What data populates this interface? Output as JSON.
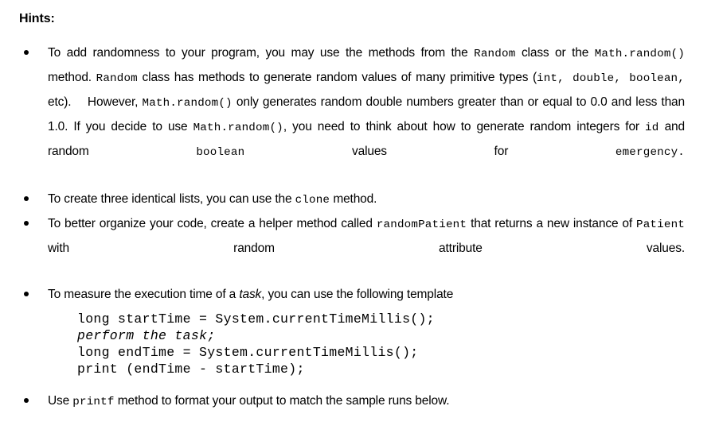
{
  "document": {
    "heading": "Hints:",
    "bullets": [
      {
        "id": "randomness",
        "segments": [
          {
            "text": "To add randomness to your program, you may use the methods from the ",
            "style": "normal"
          },
          {
            "text": "Random",
            "style": "code"
          },
          {
            "text": " class or the ",
            "style": "normal"
          },
          {
            "text": "Math.random()",
            "style": "code"
          },
          {
            "text": " method. ",
            "style": "normal"
          },
          {
            "text": "Random",
            "style": "code"
          },
          {
            "text": " class has methods to generate random values of many primitive types (",
            "style": "normal"
          },
          {
            "text": "int, double, boolean,",
            "style": "code"
          },
          {
            "text": " etc).  However, ",
            "style": "normal"
          },
          {
            "text": "Math.random()",
            "style": "code"
          },
          {
            "text": " only generates random double numbers greater than or equal to 0.0 and  less than 1.0. If you decide to use ",
            "style": "normal"
          },
          {
            "text": "Math.random()",
            "style": "code"
          },
          {
            "text": ", you need to think about how to generate random integers for ",
            "style": "normal"
          },
          {
            "text": "id",
            "style": "code"
          },
          {
            "text": " and random ",
            "style": "normal"
          },
          {
            "text": "boolean",
            "style": "code"
          },
          {
            "text": " values for ",
            "style": "normal"
          },
          {
            "text": "emergency.",
            "style": "code"
          }
        ]
      },
      {
        "id": "clone",
        "justify": false,
        "segments": [
          {
            "text": "To create three identical lists, you can use the ",
            "style": "normal"
          },
          {
            "text": "clone",
            "style": "code"
          },
          {
            "text": " method.",
            "style": "normal"
          }
        ]
      },
      {
        "id": "helper-method",
        "segments": [
          {
            "text": "To better organize your code, create a helper method called ",
            "style": "normal"
          },
          {
            "text": "randomPatient",
            "style": "code"
          },
          {
            "text": " that returns a new instance of ",
            "style": "normal"
          },
          {
            "text": "Patient",
            "style": "code"
          },
          {
            "text": " with random attribute values.",
            "style": "normal"
          }
        ]
      },
      {
        "id": "execution-time",
        "justify": false,
        "segments": [
          {
            "text": "To measure the execution time of a ",
            "style": "normal"
          },
          {
            "text": "task",
            "style": "italic"
          },
          {
            "text": ", you can use the following template",
            "style": "normal"
          }
        ]
      }
    ],
    "code_block": {
      "lines": [
        {
          "text": "long startTime = System.currentTimeMillis();",
          "style": "normal"
        },
        {
          "text": "perform the task;",
          "style": "italic"
        },
        {
          "text": "long endTime = System.currentTimeMillis();",
          "style": "normal"
        },
        {
          "text": "print (endTime - startTime);",
          "style": "normal"
        }
      ]
    },
    "final_bullet": {
      "id": "printf",
      "segments": [
        {
          "text": "Use ",
          "style": "normal"
        },
        {
          "text": "printf",
          "style": "code"
        },
        {
          "text": " method to format your output to match the sample runs below.",
          "style": "normal"
        }
      ]
    },
    "colors": {
      "background": "#ffffff",
      "text": "#000000"
    }
  }
}
